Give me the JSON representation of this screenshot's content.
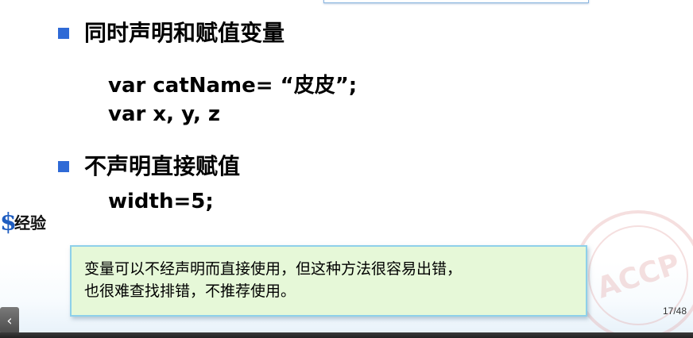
{
  "slide": {
    "bullets": [
      {
        "text": "同时声明和赋值变量"
      },
      {
        "text": "不声明直接赋值"
      }
    ],
    "code": {
      "line1": "var catName= “皮皮”;",
      "line2": "var x, y, z",
      "line3": "width=5;"
    },
    "side_label": {
      "icon_name": "dollar-icon",
      "icon_glyph": "$",
      "text": "经验"
    },
    "note": {
      "line1": "变量可以不经声明而直接使用，但这种方法很容易出错，",
      "line2": "也很难查找排错，不推荐使用。"
    },
    "watermark_text": "ACCP",
    "page_number": "17/48",
    "prev_button_glyph": "‹"
  },
  "colors": {
    "bullet": "#2f6ad6",
    "note_background": "#e6f8d8",
    "note_border": "#8ed0ea",
    "icon": "#1f5dc0"
  }
}
